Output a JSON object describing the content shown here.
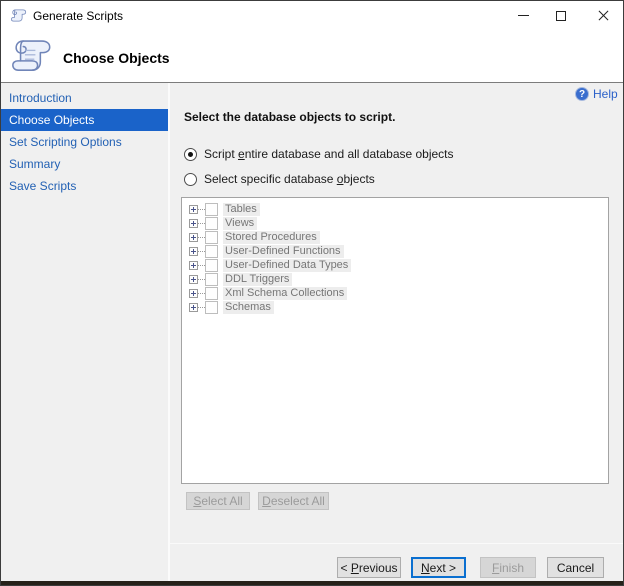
{
  "window": {
    "title": "Generate Scripts"
  },
  "header": {
    "title": "Choose Objects"
  },
  "sidebar": {
    "items": [
      {
        "label": "Introduction",
        "selected": false
      },
      {
        "label": "Choose Objects",
        "selected": true
      },
      {
        "label": "Set Scripting Options",
        "selected": false
      },
      {
        "label": "Summary",
        "selected": false
      },
      {
        "label": "Save Scripts",
        "selected": false
      }
    ]
  },
  "main": {
    "help": {
      "label": "Help",
      "icon_glyph": "?"
    },
    "instruction": "Select the database objects to script.",
    "radios": [
      {
        "pre": "Script ",
        "key": "e",
        "post": "ntire database and all database objects",
        "selected": true
      },
      {
        "pre": "Select specific database ",
        "key": "o",
        "post": "bjects",
        "selected": false
      }
    ],
    "tree": {
      "items": [
        "Tables",
        "Views",
        "Stored Procedures",
        "User-Defined Functions",
        "User-Defined Data Types",
        "DDL Triggers",
        "Xml Schema Collections",
        "Schemas"
      ]
    },
    "buttons": {
      "select_all": {
        "key": "S",
        "post": "elect All",
        "disabled": true
      },
      "deselect_all": {
        "key": "D",
        "post": "eselect All",
        "disabled": true
      }
    }
  },
  "footer": {
    "previous": {
      "pre": "< ",
      "key": "P",
      "post": "revious"
    },
    "next": {
      "key": "N",
      "post": "ext >",
      "default": true
    },
    "finish": {
      "key": "F",
      "post": "inish",
      "disabled": true
    },
    "cancel": {
      "label": "Cancel"
    }
  },
  "colors": {
    "accent": "#1a63c9",
    "link": "#2361b4",
    "help-link": "#2b61c9",
    "focus": "#0a6fd0",
    "tree-text": "#767676",
    "disabled-text": "#9b9b9b"
  }
}
